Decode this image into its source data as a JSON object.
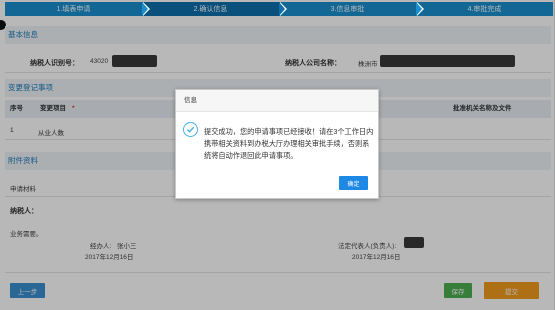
{
  "steps": [
    {
      "label": "1.填表申请",
      "active": false
    },
    {
      "label": "2.确认信息",
      "active": true
    },
    {
      "label": "3.信息审批",
      "active": false
    },
    {
      "label": "4.审批完成",
      "active": false
    }
  ],
  "basic_info": {
    "title": "基本信息",
    "taxpayer_id_label": "纳税人识别号：",
    "taxpayer_id_value": "43020",
    "company_name_label": "纳税人公司名称：",
    "company_name_value": "株洲市"
  },
  "change_items": {
    "title": "变更登记事项",
    "columns": [
      "序号",
      "变更项目",
      "*",
      "批准机关名称及文件"
    ],
    "rows": [
      {
        "index": "1",
        "item": "从业人数"
      }
    ]
  },
  "attachments": {
    "title": "附件资料",
    "apply_material_label": "申请材料"
  },
  "taxpayer": {
    "label": "纳税人：",
    "stamp_text": "业务需要。",
    "handler_label": "经办人:",
    "handler_name": "张小三",
    "handler_date": "2017年12月16日",
    "legal_rep_label": "法定代表人(负责人):",
    "legal_rep_date": "2017年12月16日"
  },
  "buttons": {
    "prev": "上一步",
    "save": "保存",
    "submit": "提交"
  },
  "dialog": {
    "title": "信息",
    "message": "提交成功，您的申请事项已经接收！请在3个工作日内携带相关资料到办税大厅办理相关审批手续，否则系统将自动作退回此申请事项。",
    "ok": "确定"
  },
  "colors": {
    "step_bg": "#1a8fcf",
    "step_active": "#0e6fae",
    "section_text": "#1d7ab8",
    "btn_prev": "#3a8fd1",
    "btn_save": "#4caf50",
    "btn_submit": "#f29b1d",
    "dialog_ok": "#1e88e5",
    "success_icon": "#43b0e3"
  }
}
